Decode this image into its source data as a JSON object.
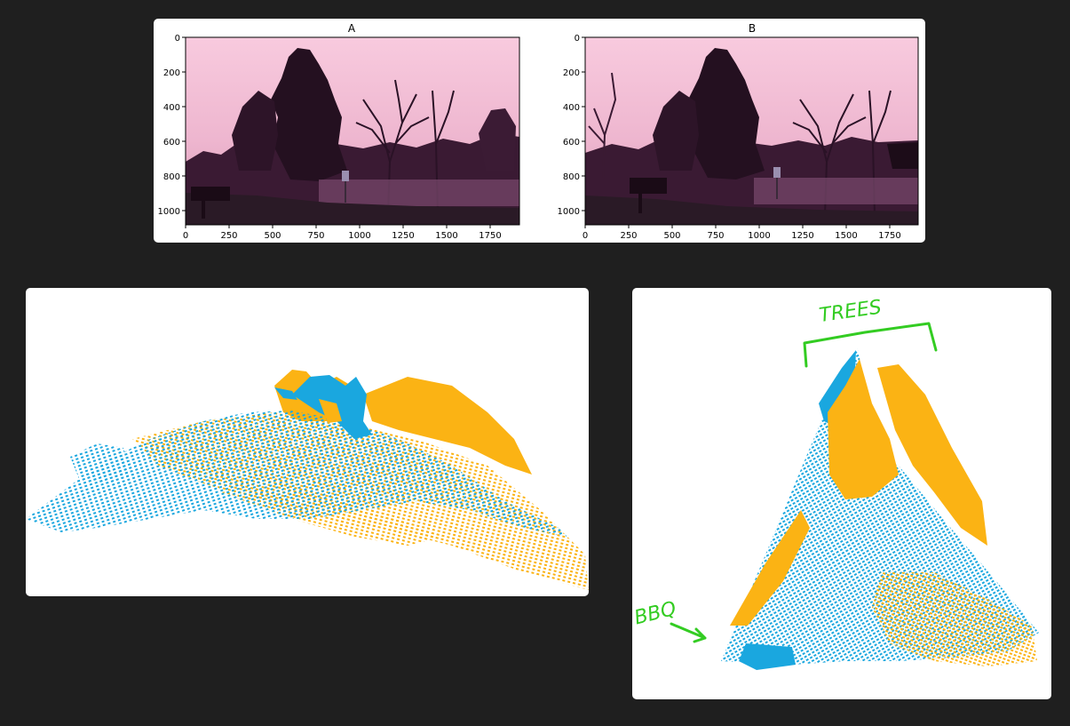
{
  "colors": {
    "background": "#1f1f1f",
    "cloud_a": "#1aa7df",
    "cloud_b": "#fbb314",
    "annotation": "#33cc22",
    "sky_top": "#f7c6d8",
    "sky_bottom": "#ebb0cb",
    "foliage": "#2a1226"
  },
  "plots": {
    "a": {
      "title": "A",
      "xticks": [
        "0",
        "250",
        "500",
        "750",
        "1000",
        "1250",
        "1500",
        "1750"
      ],
      "yticks": [
        "0",
        "200",
        "400",
        "600",
        "800",
        "1000"
      ]
    },
    "b": {
      "title": "B",
      "xticks": [
        "0",
        "250",
        "500",
        "750",
        "1000",
        "1250",
        "1500",
        "1750"
      ],
      "yticks": [
        "0",
        "200",
        "400",
        "600",
        "800",
        "1000"
      ]
    }
  },
  "annotations": {
    "trees": "TREES",
    "bbq": "BBQ"
  }
}
